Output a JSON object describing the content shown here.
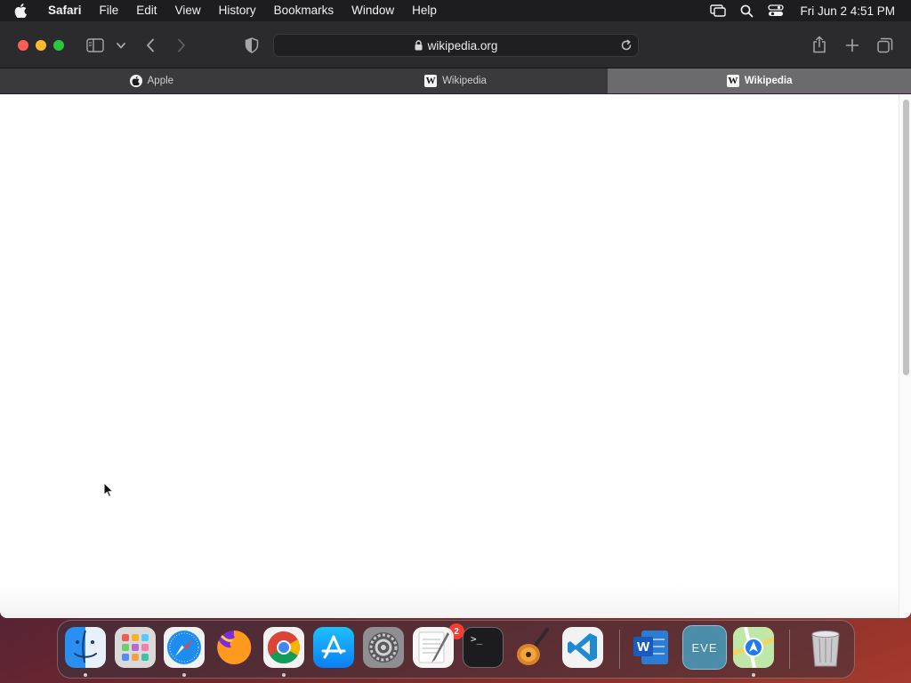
{
  "menubar": {
    "app_name": "Safari",
    "items": [
      "File",
      "Edit",
      "View",
      "History",
      "Bookmarks",
      "Window",
      "Help"
    ],
    "clock": "Fri Jun 2  4:51 PM",
    "icons": [
      "apple-logo-icon",
      "screen-mirroring-icon",
      "spotlight-search-icon",
      "control-center-icon"
    ]
  },
  "toolbar": {
    "address": "wikipedia.org",
    "icons": [
      "sidebar-icon",
      "chevron-down-icon",
      "back-icon",
      "forward-icon",
      "privacy-shield-icon",
      "lock-icon",
      "reload-icon",
      "share-icon",
      "new-tab-icon",
      "tab-overview-icon"
    ]
  },
  "tabs": [
    {
      "label": "Apple",
      "favicon": "apple-favicon-icon",
      "active": false
    },
    {
      "label": "Wikipedia",
      "favicon": "wikipedia-favicon-icon",
      "active": false
    },
    {
      "label": "Wikipedia",
      "favicon": "wikipedia-favicon-icon",
      "active": true
    }
  ],
  "dock": {
    "apps": [
      "Finder",
      "Launchpad",
      "Safari",
      "Firefox",
      "Google Chrome",
      "App Store",
      "System Settings",
      "TextEdit",
      "Terminal",
      "GarageBand",
      "Visual Studio Code",
      "Microsoft Word",
      "EVE",
      "Maps",
      "Trash"
    ],
    "system_settings_badge": "2",
    "wikipedia_favicon_letter": "W",
    "word_letter": "W",
    "eve_label": "EVE",
    "terminal_prompt": ">_"
  },
  "colors": {
    "traffic_red": "#ff5f57",
    "traffic_yellow": "#febc2e",
    "traffic_green": "#28c840",
    "active_tab": "#6b6b6e",
    "badge": "#ff3b30"
  }
}
